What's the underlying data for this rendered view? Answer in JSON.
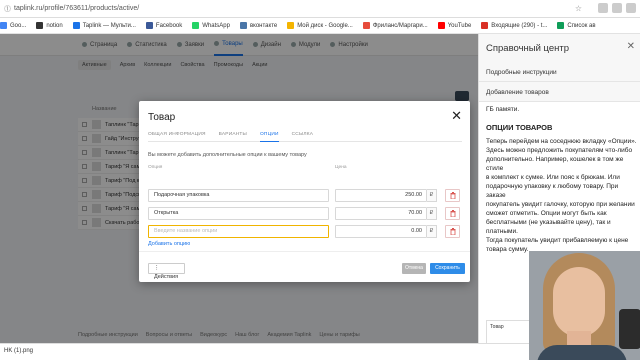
{
  "browser": {
    "url": "taplink.ru/profile/763611/products/active/",
    "bookmarks": [
      {
        "label": "Goo...",
        "color": "#4285f4"
      },
      {
        "label": "notion",
        "color": "#333333"
      },
      {
        "label": "Taplink — Мульти...",
        "color": "#1a73e8"
      },
      {
        "label": "Facebook",
        "color": "#3b5998"
      },
      {
        "label": "WhatsApp",
        "color": "#25d366"
      },
      {
        "label": "вконтакте",
        "color": "#4a76a8"
      },
      {
        "label": "Мой диск - Google...",
        "color": "#f4b400"
      },
      {
        "label": "Фриланс/Маргари...",
        "color": "#e74c3c"
      },
      {
        "label": "YouTube",
        "color": "#ff0000"
      },
      {
        "label": "Входящие (290) - t...",
        "color": "#d93025"
      },
      {
        "label": "Список ав",
        "color": "#0f9d58"
      }
    ],
    "download": "HK (1).png"
  },
  "app": {
    "nav": [
      {
        "label": "Страница",
        "active": false
      },
      {
        "label": "Статистика",
        "active": false
      },
      {
        "label": "Заявки",
        "active": false
      },
      {
        "label": "Товары",
        "active": true
      },
      {
        "label": "Дизайн",
        "active": false
      },
      {
        "label": "Модули",
        "active": false
      },
      {
        "label": "Настройки",
        "active": false
      }
    ],
    "subnav": [
      {
        "label": "Активные",
        "active": true
      },
      {
        "label": "Архив",
        "active": false
      },
      {
        "label": "Коллекции",
        "active": false
      },
      {
        "label": "Свойства",
        "active": false
      },
      {
        "label": "Промокоды",
        "active": false
      },
      {
        "label": "Акции",
        "active": false
      }
    ],
    "list_header": "Название",
    "products": [
      "Таплинк \"Тариф Ст...",
      "Гайд \"Инструкция...",
      "Таплинк \"Тариф ...",
      "Тариф \"Я сам\" со ...",
      "Тариф \"Под ключ...",
      "Тариф \"Подсказки...",
      "Тариф \"Я сам\" + ...",
      "Скачать рабочую ..."
    ],
    "footer_links": [
      "Подробные инструкции",
      "Вопросы и ответы",
      "Видеокурс",
      "Наш блог",
      "Академия Taplink",
      "Цены и тарифы"
    ]
  },
  "modal": {
    "title": "Товар",
    "tabs": [
      {
        "label": "ОБЩАЯ ИНФОРМАЦИЯ",
        "active": false
      },
      {
        "label": "ВАРИАНТЫ",
        "active": false
      },
      {
        "label": "ОПЦИИ",
        "active": true
      },
      {
        "label": "ССЫЛКА",
        "active": false
      }
    ],
    "hint": "Вы можете добавить дополнительные опции к вашему товару",
    "col_option": "Опция",
    "col_price": "Цена",
    "options": [
      {
        "name": "Подарочная упаковка",
        "price": "250.00",
        "currency": "₽"
      },
      {
        "name": "Открытка",
        "price": "70.00",
        "currency": "₽"
      }
    ],
    "new_option_placeholder": "Введите название опции",
    "new_option_price": "0.00",
    "currency": "₽",
    "add_option": "Добавить опцию",
    "actions_label": "Действия",
    "cancel_label": "Отмена",
    "save_label": "Сохранить"
  },
  "help": {
    "title": "Справочный центр",
    "nav1": "Подробные инструкции",
    "nav2": "Добавление товаров",
    "lead": "ГБ памяти.",
    "heading": "ОПЦИИ ТОВАРОВ",
    "body": "Теперь перейдем на соседнюю вкладку «Опции».\nЗдесь можно предложить покупателям что-либо\nдополнительно. Например, кошелек в том же стиле\nв комплект к сумке. Или пояс к брюкам. Или\nподарочную упаковку к любому товару. При заказе\nпокупатель увидит галочку, которую при желании\nсможет отметить. Опции могут быть как\nбесплатными (не указывайте цену), так и платными.\nТогда покупатель увидит прибавляемую к цене\nтовара сумму.",
    "preview_label": "Товар"
  }
}
